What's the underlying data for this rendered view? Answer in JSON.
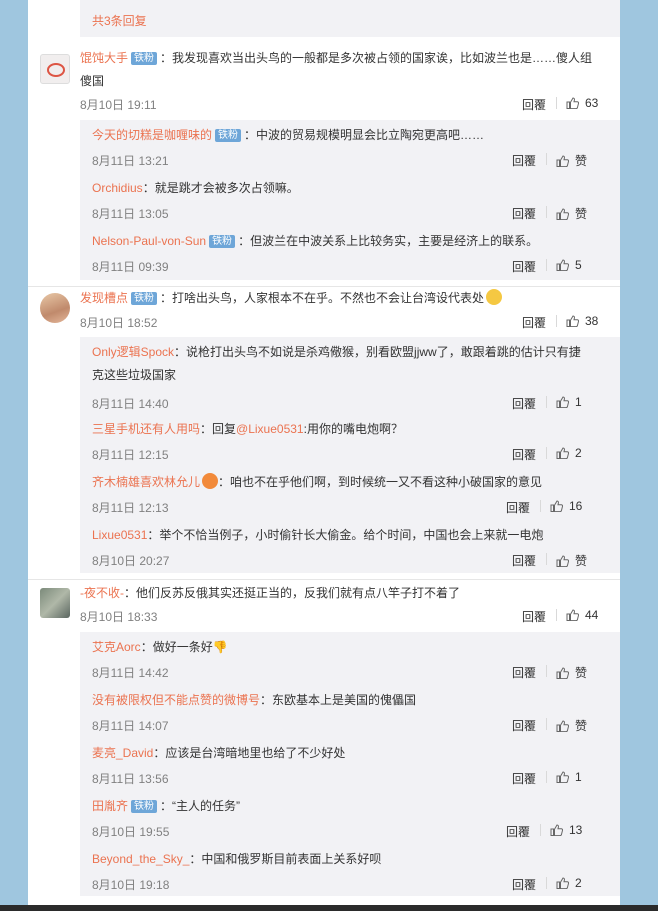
{
  "top_more": "共3条回复",
  "reply_label": "回覆",
  "comments": [
    {
      "user": "馄饨大手",
      "badge": "铁粉",
      "text": "：我发现喜欢当出头鸟的一般都是多次被占领的国家诶，比如波兰也是……傻人组",
      "text2": "傻国",
      "time": "8月10日 19:11",
      "likes": "63",
      "replies": [
        {
          "user": "今天的切糕是咖喱味的",
          "badge": "铁粉",
          "text": "：中波的贸易规模明显会比立陶宛更高吧……",
          "time": "8月11日 13:21",
          "likes": "赞"
        },
        {
          "user": "Orchidius",
          "badge": "",
          "text": "：就是跳才会被多次占领嘛。",
          "time": "8月11日 13:05",
          "likes": "赞"
        },
        {
          "user": "Nelson-Paul-von-Sun",
          "badge": "铁粉",
          "text": "：但波兰在中波关系上比较务实，主要是经济上的联系。",
          "time": "8月11日 09:39",
          "likes": "5"
        }
      ]
    },
    {
      "user": "发现槽点",
      "badge": "铁粉",
      "text": "：打啥出头鸟，人家根本不在乎。不然也不会让台湾设代表处",
      "time": "8月10日 18:52",
      "likes": "38",
      "replies": [
        {
          "user": "Only逻辑Spock",
          "badge": "",
          "text": "：说枪打出头鸟不如说是杀鸡儆猴，别看欧盟jjww了，敢跟着跳的估计只有捷",
          "text2": "克这些垃圾国家",
          "time": "8月11日 14:40",
          "likes": "1"
        },
        {
          "user": "三星手机还有人用吗",
          "badge": "",
          "text": "：回复",
          "mention": "@Lixue0531",
          "text_after": ":用你的嘴电炮啊？",
          "time": "8月11日 12:15",
          "likes": "2"
        },
        {
          "user": "齐木楠雄喜欢林允儿",
          "badge": "",
          "text": "：咱也不在乎他们啊，到时候统一又不看这种小破国家的意见",
          "time": "8月11日 12:13",
          "likes": "16"
        },
        {
          "user": "Lixue0531",
          "badge": "",
          "text": "：举个不恰当例子，小时偷针长大偷金。给个时间，中国也会上来就一电炮",
          "time": "8月10日 20:27",
          "likes": "赞"
        }
      ]
    },
    {
      "user": "-夜不收-",
      "badge": "",
      "text": "：他们反苏反俄其实还挺正当的，反我们就有点八竿子打不着了",
      "time": "8月10日 18:33",
      "likes": "44",
      "replies": [
        {
          "user": "艾克Aorc",
          "badge": "",
          "text": "：做好一条好👎",
          "time": "8月11日 14:42",
          "likes": "赞"
        },
        {
          "user": "没有被限权但不能点赞的微博号",
          "badge": "",
          "text": "：东欧基本上是美国的傀儡国",
          "time": "8月11日 14:07",
          "likes": "赞"
        },
        {
          "user": "麦亮_David",
          "badge": "",
          "text": "：应该是台湾暗地里也给了不少好处",
          "time": "8月11日 13:56",
          "likes": "1"
        },
        {
          "user": "田胤齐",
          "badge": "铁粉",
          "text": "：“主人的任务”",
          "time": "8月10日 19:55",
          "likes": "13"
        },
        {
          "user": "Beyond_the_Sky_",
          "badge": "",
          "text": "：中国和俄罗斯目前表面上关系好呗",
          "time": "8月10日 19:18",
          "likes": "2"
        }
      ]
    }
  ]
}
